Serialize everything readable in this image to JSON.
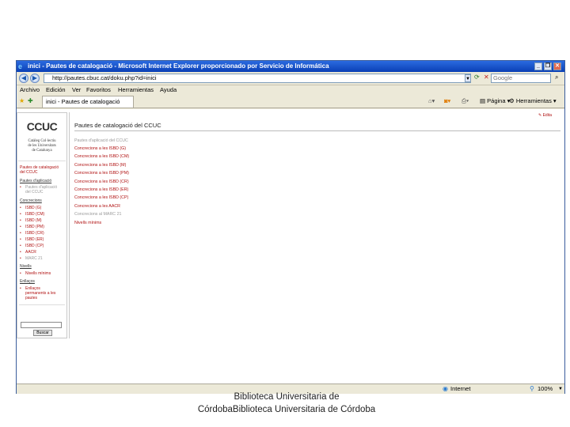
{
  "window": {
    "title": "inici - Pautes de catalogació - Microsoft Internet Explorer proporcionado por Servicio de Informática",
    "minimize": "_",
    "restore": "❐",
    "close": "✕"
  },
  "address_bar": {
    "url": "http://pautes.cbuc.cat/doku.php?id=inici",
    "search_placeholder": "Google"
  },
  "menu": [
    "Archivo",
    "Edición",
    "Ver",
    "Favoritos",
    "Herramientas",
    "Ayuda"
  ],
  "tab": {
    "label": "inici - Pautes de catalogació"
  },
  "command_bar": {
    "page": "Página",
    "tools": "Herramientas"
  },
  "page": {
    "edit_link": "Edita",
    "logo": {
      "mark": "CCUC",
      "caption": [
        "Catàleg Col·lectiu",
        "de les Universitats",
        "de Catalunya"
      ]
    },
    "sidebar": {
      "top_links": [
        "Pautes de catalogació",
        "del CCUC"
      ],
      "section_application": "Pautes d'aplicació",
      "application_items": [
        "Pautes d'aplicació",
        "del CCUC"
      ],
      "section_concrecions": "Concrecions",
      "concrecions_items": [
        "ISBD (G)",
        "ISBD (CM)",
        "ISBD (M)",
        "ISBD (PM)",
        "ISBD (CR)",
        "ISBD (ER)",
        "ISBD (CP)",
        "AACR",
        "MARC 21"
      ],
      "section_levels": "Nivells",
      "levels_items": [
        "Nivells mínims"
      ],
      "section_links": "Enllaços",
      "links_items": [
        "Enllaços",
        "permanents a les",
        "pautes"
      ],
      "search_button": "Buscar"
    },
    "main": {
      "title": "Pautes de catalogació del CCUC",
      "links": [
        "Pautes d'aplicació del CCUC",
        "Concrecions a les ISBD (G)",
        "Concrecions a les ISBD (CM)",
        "Concrecions a les ISBD (M)",
        "Concrecions a les ISBD (PM)",
        "Concrecions a les ISBD (CR)",
        "Concrecions a les ISBD (ER)",
        "Concrecions a les ISBD (CP)",
        "Concrecions a les AACR",
        "Concrecions al MARC 21",
        "Nivells mínims"
      ]
    }
  },
  "status_bar": {
    "zone": "Internet",
    "zoom": "100%"
  },
  "slide_caption": [
    "Biblioteca Universitaria de",
    "CórdobaBiblioteca Universitaria de Córdoba"
  ]
}
